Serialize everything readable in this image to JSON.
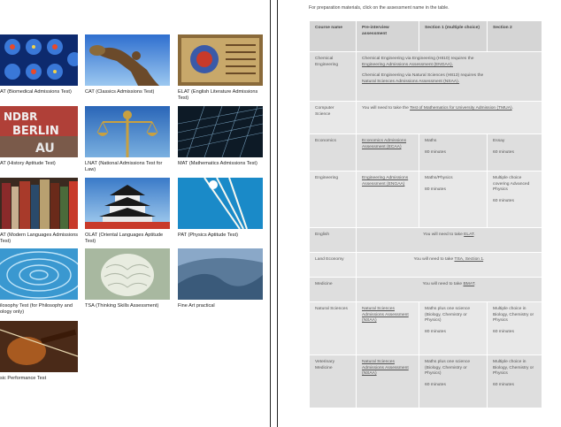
{
  "tiles": [
    {
      "caption": "AT (Biomedical Admissions Test)",
      "icon": "brain-scan-image",
      "color": "#1b3f8a"
    },
    {
      "caption": "CAT (Classics Admissions Test)",
      "icon": "discus-thrower-statue-image",
      "color": "#3b7fd0"
    },
    {
      "caption": "ELAT (English Literature Admissions Test)",
      "icon": "illuminated-manuscript-image",
      "color": "#6a4a1e"
    },
    {
      "caption": "AT (History Aptitude Test)",
      "icon": "berlin-wall-graffiti-image",
      "color": "#8a2a2a"
    },
    {
      "caption": "LNAT (National Admissions Test for Law)",
      "icon": "justice-statue-image",
      "color": "#2f6fb0"
    },
    {
      "caption": "MAT (Mathematics Admissions Test)",
      "icon": "wireframe-grid-image",
      "color": "#1a2a3a"
    },
    {
      "caption": "AT (Modern Languages Admissions Test)",
      "icon": "books-image",
      "color": "#5a3a2a"
    },
    {
      "caption": "OLAT (Oriental Languages Aptitude Test)",
      "icon": "japanese-castle-image",
      "color": "#2a5a8a"
    },
    {
      "caption": "PAT (Physics Aptitude Test)",
      "icon": "light-beams-image",
      "color": "#2a9ad0"
    },
    {
      "caption": "ilosophy Test (for Philosophy and ology only)",
      "icon": "water-ripple-image",
      "color": "#4aa8d8"
    },
    {
      "caption": "TSA (Thinking Skills Assessment)",
      "icon": "brain-sculpture-image",
      "color": "#b8c8b0"
    },
    {
      "caption": "Fine Art practical",
      "icon": "painted-canvas-image",
      "color": "#4a6a8a"
    },
    {
      "caption": "sic Performance Test",
      "icon": "violin-image",
      "color": "#6a3a1a"
    }
  ],
  "intro": "For preparation materials, click on the assessment name in the table.",
  "table": {
    "headers": [
      "Course name",
      "Pre-interview assessment",
      "Section 1 (multiple choice)",
      "Section 2"
    ],
    "rows": {
      "chem": {
        "course": "Chemical Engineering",
        "l1a": "Chemical Engineering via Engineering (H810) requires the",
        "l1b": "Engineering Admissions Assessment (ENGAA).",
        "l2a": "Chemical Engineering via Natural Sciences (H813) requires the",
        "l2b": "Natural Sciences Admissions Assessment (NSAA)."
      },
      "cs": {
        "course": "Computer Science",
        "pre": "You will need to take the ",
        "link": "Test of Mathematics for University Admission (TMUA)",
        "post": "."
      },
      "econ": {
        "course": "Economics",
        "assessment": "Economics Admissions Assessment (ECAA)",
        "s1": "Maths",
        "s1time": "80 minutes",
        "s2": "Essay",
        "s2time": "60 minutes"
      },
      "eng": {
        "course": "Engineering",
        "assessment": "Engineering Admissions Assessment (ENGAA)",
        "s1": "Maths/Physics",
        "s1time": "80 minutes",
        "s2": "Multiple choice covering Advanced Physics",
        "s2time": "60 minutes"
      },
      "english": {
        "course": "English",
        "pre": "You will need to take ",
        "link": "ELAT",
        "post": "."
      },
      "land": {
        "course": "Land Economy",
        "pre": "You will need to take ",
        "link": "TSA, Section 1",
        "post": "."
      },
      "med": {
        "course": "Medicine",
        "pre": "You will need to take ",
        "link": "BMAT",
        "post": "."
      },
      "nat": {
        "course": "Natural Sciences",
        "assessment": "Natural Sciences Admissions Assessment (NSAA)",
        "s1": "Maths plus one science (Biology, Chemistry or Physics)",
        "s1time": "80 minutes",
        "s2": "Multiple choice in Biology, Chemistry or Physics",
        "s2time": "60 minutes"
      },
      "vet": {
        "course": "Veterinary Medicine",
        "assessment": "Natural Sciences Admissions Assessment (NSAA)",
        "s1": "Maths plus one science (Biology, Chemistry or Physics)",
        "s1time": "60 minutes",
        "s2": "Multiple choice in Biology, Chemistry or Physics",
        "s2time": "60 minutes"
      }
    }
  }
}
